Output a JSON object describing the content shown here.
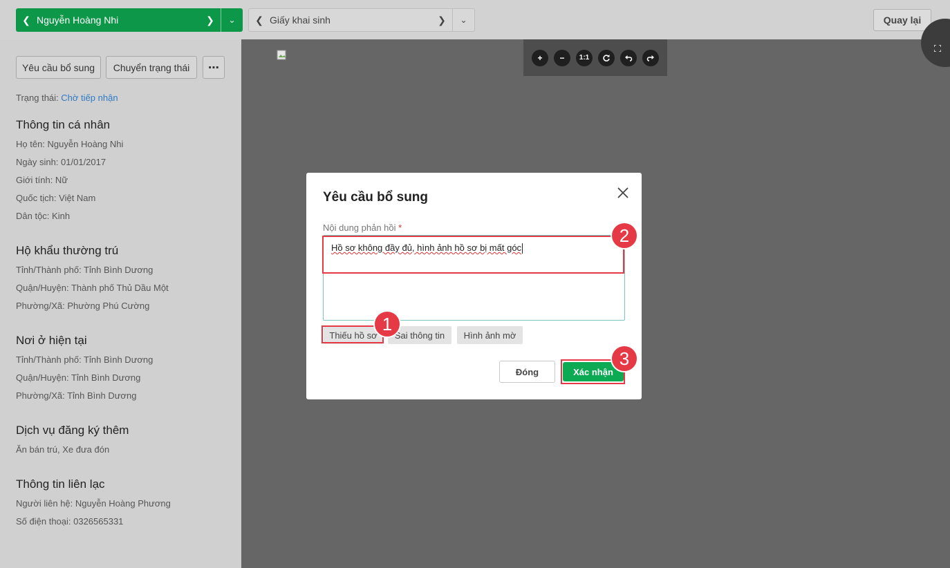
{
  "topbar": {
    "student_name": "Nguyễn Hoàng Nhi",
    "document_type": "Giấy khai sinh",
    "back_label": "Quay lại"
  },
  "sidebar": {
    "actions": {
      "request_more": "Yêu cầu bổ sung",
      "change_status": "Chuyển trạng thái",
      "more": "⋯"
    },
    "status": {
      "label": "Trạng thái:",
      "value": "Chờ tiếp nhận"
    },
    "sections": [
      {
        "title": "Thông tin cá nhân",
        "fields": [
          "Họ tên: Nguyễn Hoàng Nhi",
          "Ngày sinh: 01/01/2017",
          "Giới tính: Nữ",
          "Quốc tịch: Việt Nam",
          "Dân tộc: Kinh"
        ]
      },
      {
        "title": "Hộ khẩu thường trú",
        "fields": [
          "Tỉnh/Thành phố: Tỉnh Bình Dương",
          "Quận/Huyện: Thành phố Thủ Dầu Một",
          "Phường/Xã: Phường Phú Cường"
        ]
      },
      {
        "title": "Nơi ở hiện tại",
        "fields": [
          "Tỉnh/Thành phố: Tỉnh Bình Dương",
          "Quận/Huyện: Tỉnh Bình Dương",
          "Phường/Xã: Tỉnh Bình Dương"
        ]
      },
      {
        "title": "Dịch vụ đăng ký thêm",
        "fields": [
          "Ăn bán trú, Xe đưa đón"
        ]
      },
      {
        "title": "Thông tin liên lạc",
        "fields": [
          "Người liên hệ: Nguyễn Hoàng Phương",
          "Số điện thoại: 0326565331"
        ]
      }
    ]
  },
  "viewer": {
    "zoom_controls": [
      "+",
      "−",
      "1:1",
      "rotate-right-icon",
      "undo-icon",
      "redo-icon"
    ],
    "zoom_in": "+",
    "zoom_out": "−",
    "actual_size": "1:1"
  },
  "modal": {
    "title": "Yêu cầu bổ sung",
    "field_label": "Nội dung phản hồi",
    "required_mark": "*",
    "textarea_value": "Hồ sơ không đầy đủ, hình ảnh hồ sơ bị mất góc",
    "chips": [
      "Thiếu hồ sơ",
      "Sai thông tin",
      "Hình ảnh mờ"
    ],
    "close_label": "Đóng",
    "confirm_label": "Xác nhận"
  },
  "annotations": {
    "badges": [
      "1",
      "2",
      "3"
    ],
    "color": "#e63946"
  },
  "colors": {
    "primary_green": "#0d9748",
    "confirm_green": "#0daa54",
    "link_blue": "#2e7bc4",
    "viewer_bg": "#666666"
  }
}
